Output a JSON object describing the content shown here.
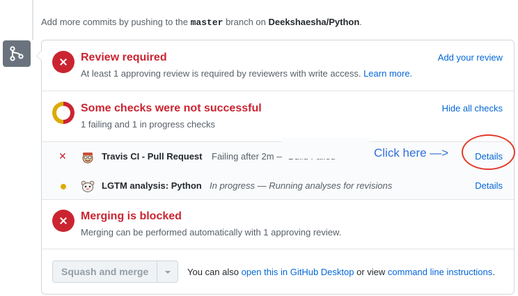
{
  "push_note": {
    "prefix": "Add more commits by pushing to the",
    "branch": "master",
    "middle": "branch on",
    "repo": "Deekshaesha/Python",
    "suffix": "."
  },
  "review": {
    "title": "Review required",
    "description": "At least 1 approving review is required by reviewers with write access.",
    "learn_more": "Learn more.",
    "action": "Add your review"
  },
  "checks": {
    "title": "Some checks were not successful",
    "description": "1 failing and 1 in progress checks",
    "action": "Hide all checks",
    "items": [
      {
        "status": "failing",
        "status_glyph": "✕",
        "name": "Travis CI - Pull Request",
        "description": "Failing after 2m — Build Failed",
        "details": "Details",
        "avatar_icon": "travis-ci-icon"
      },
      {
        "status": "in_progress",
        "name": "LGTM analysis: Python",
        "description": "In progress — Running analyses for revisions",
        "details": "Details",
        "avatar_icon": "lgtm-icon"
      }
    ]
  },
  "annotation": {
    "text": "Click here —>",
    "color": "#e23b2a"
  },
  "merge": {
    "title": "Merging is blocked",
    "description": "Merging can be performed automatically with 1 approving review."
  },
  "actions": {
    "squash_label": "Squash and merge",
    "text_prefix": "You can also",
    "desktop_link": "open this in GitHub Desktop",
    "text_middle": "or view",
    "cli_link": "command line instructions",
    "text_suffix": "."
  },
  "colors": {
    "error": "#cb2431",
    "pending": "#dbab09",
    "link": "#0366d6"
  }
}
